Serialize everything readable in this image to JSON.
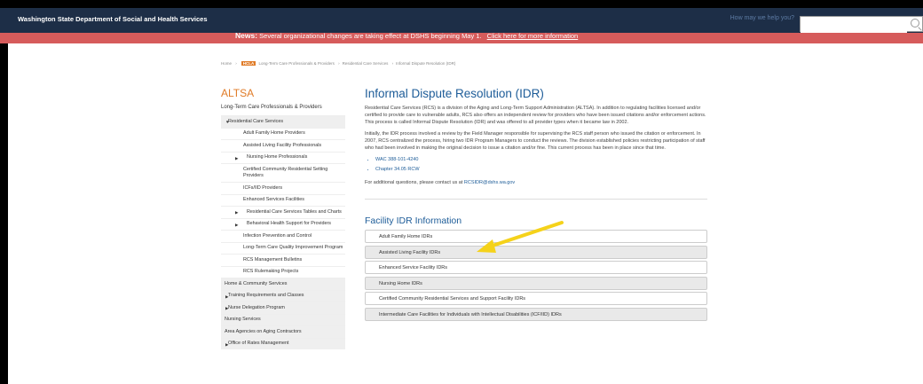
{
  "header": {
    "brand": "Washington State Department of Social and Health Services",
    "help_link": "How may we help you?",
    "search_placeholder": ""
  },
  "news": {
    "label": "News:",
    "text": "Several organizational changes are taking effect at DSHS beginning May 1.",
    "link": "Click here for more information"
  },
  "breadcrumb": {
    "home": "Home",
    "tag": "HCLA",
    "items": [
      "Long-Term Care Professionals & Providers",
      "Residential Care Services",
      "Informal Dispute Resolution (IDR)"
    ]
  },
  "sidebar": {
    "title": "ALTSA",
    "subtitle": "Long-Term Care Professionals & Providers",
    "items": [
      {
        "label": "Residential Care Services",
        "level": 1,
        "tri": "▼"
      },
      {
        "label": "Adult Family Home Providers",
        "level": 2,
        "tri": ""
      },
      {
        "label": "Assisted Living Facility Professionals",
        "level": 2,
        "tri": ""
      },
      {
        "label": "Nursing Home Professionals",
        "level": 2,
        "tri": "▶"
      },
      {
        "label": "Certified Community Residential Setting Providers",
        "level": 2,
        "tri": ""
      },
      {
        "label": "ICFs/IID Providers",
        "level": 2,
        "tri": ""
      },
      {
        "label": "Enhanced Services Facilities",
        "level": 2,
        "tri": ""
      },
      {
        "label": "Residential Care Services Tables and Charts",
        "level": 2,
        "tri": "▶"
      },
      {
        "label": "Behavioral Health Support for Providers",
        "level": 2,
        "tri": "▶"
      },
      {
        "label": "Infection Prevention and Control",
        "level": 2,
        "tri": ""
      },
      {
        "label": "Long-Term Care Quality Improvement Program",
        "level": 2,
        "tri": ""
      },
      {
        "label": "RCS Management Bulletins",
        "level": 2,
        "tri": ""
      },
      {
        "label": "RCS Rulemaking Projects",
        "level": 2,
        "tri": ""
      },
      {
        "label": "Home & Community Services",
        "level": 1,
        "tri": ""
      },
      {
        "label": "Training Requirements and Classes",
        "level": 1,
        "tri": "▶"
      },
      {
        "label": "Nurse Delegation Program",
        "level": 1,
        "tri": "▶"
      },
      {
        "label": "Nursing Services",
        "level": 1,
        "tri": ""
      },
      {
        "label": "Area Agencies on Aging Contractors",
        "level": 1,
        "tri": ""
      },
      {
        "label": "Office of Rates Management",
        "level": 1,
        "tri": "▶"
      }
    ]
  },
  "main": {
    "title": "Informal Dispute Resolution (IDR)",
    "para1": "Residential Care Services (RCS) is a division of the Aging and Long-Term Support Administration (ALTSA). In addition to regulating facilities licensed and/or certified to provide care to vulnerable adults, RCS also offers an independent review for providers who have been issued citations and/or enforcement actions. This process is called Informal Dispute Resolution (IDR) and was offered to all provider types when it became law in 2002.",
    "para2": "Initially, the IDR process involved a review by the Field Manager responsible for supervising the RCS staff person who issued the citation or enforcement. In 2007, RCS centralized the process, hiring two IDR Program Managers to conduct the reviews. The division established policies restricting participation of staff who had been involved in making the original decision to issue a citation and/or fine. This current process has been in place since that time.",
    "links": [
      "WAC 388-101-4240",
      "Chapter 34.05 RCW"
    ],
    "contact_text": "For additional questions, please contact us at",
    "contact_email": "RCSIDR@dshs.wa.gov",
    "section_title": "Facility IDR Information",
    "accordion": [
      "Adult Family Home IDRs",
      "Assisted Living Facility IDRs",
      "Enhanced Service Facility IDRs",
      "Nursing Home IDRs",
      "Certified Community Residential Services and Support Facility IDRs",
      "Intermediate Care Facilities for Individuals with Intellectual Disabilities (ICF/IID) IDRs"
    ]
  },
  "colors": {
    "header_bg": "#1d2e47",
    "news_bg": "#d65b5b",
    "accent_orange": "#e07b27",
    "link_blue": "#1d5c98",
    "annotation_arrow": "#f5d21a"
  },
  "icons": {
    "search": "search-icon",
    "annotation": "yellow-arrow-icon"
  }
}
